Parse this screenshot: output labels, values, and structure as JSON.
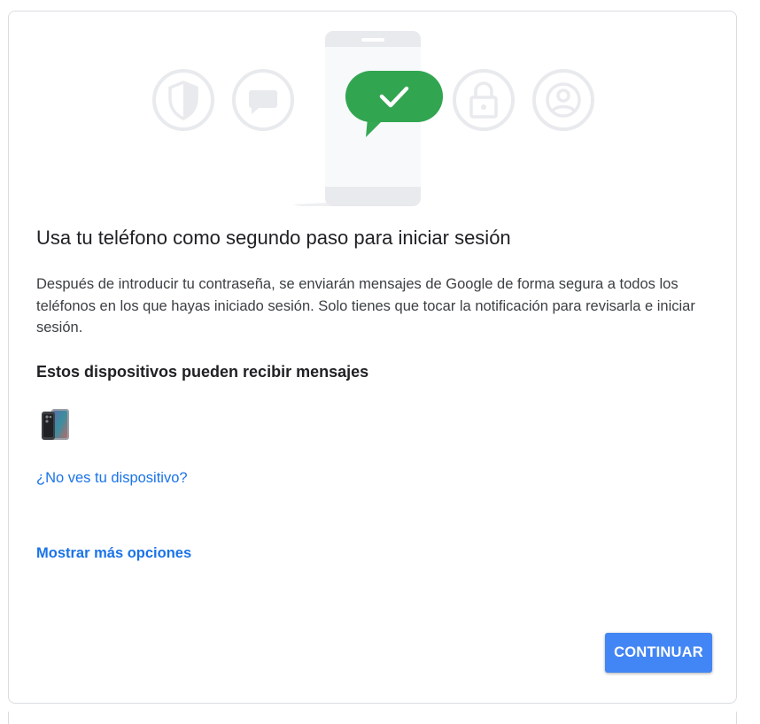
{
  "illustration": {
    "icons": [
      "shield-icon",
      "chat-bubble-icon",
      "phone-icon",
      "checkmark-bubble-icon",
      "lock-icon",
      "account-icon"
    ],
    "accent_color": "#34a853"
  },
  "main": {
    "title": "Usa tu teléfono como segundo paso para iniciar sesión",
    "description": "Después de introducir tu contraseña, se enviarán mensajes de Google de forma segura a todos los teléfonos en los que hayas iniciado sesión. Solo tienes que tocar la notificación para revisarla e iniciar sesión.",
    "devices_heading": "Estos dispositivos pueden recibir mensajes",
    "device_icon": "smartphone-icon",
    "missing_device_link": "¿No ves tu dispositivo?",
    "more_options_link": "Mostrar más opciones",
    "continue_button": "CONTINUAR"
  },
  "colors": {
    "link": "#1a73e8",
    "button": "#4285f4",
    "text_primary": "#202124",
    "text_secondary": "#3c4043"
  }
}
